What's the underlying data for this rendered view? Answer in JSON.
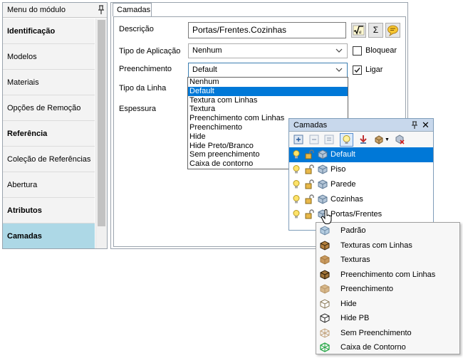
{
  "module_panel": {
    "title": "Menu do módulo",
    "pin_icon": "pin-icon",
    "items": [
      {
        "label": "Identificação",
        "bold": true,
        "selected": false
      },
      {
        "label": "Modelos",
        "bold": false,
        "selected": false
      },
      {
        "label": "Materiais",
        "bold": false,
        "selected": false
      },
      {
        "label": "Opções de Remoção",
        "bold": false,
        "selected": false
      },
      {
        "label": "Referência",
        "bold": true,
        "selected": false
      },
      {
        "label": "Coleção de Referências",
        "bold": false,
        "selected": false
      },
      {
        "label": "Abertura",
        "bold": false,
        "selected": false
      },
      {
        "label": "Atributos",
        "bold": true,
        "selected": false
      },
      {
        "label": "Camadas",
        "bold": true,
        "selected": true
      }
    ]
  },
  "main": {
    "tab_label": "Camadas",
    "descricao": {
      "label": "Descrição",
      "value": "Portas/Frentes.Cozinhas",
      "buttons": [
        "sqrt-icon",
        "Σ",
        "comment-icon"
      ]
    },
    "tipo_aplicacao": {
      "label": "Tipo de Aplicação",
      "value": "Nenhum"
    },
    "bloquear": {
      "label": "Bloquear",
      "checked": false
    },
    "preenchimento": {
      "label": "Preenchimento",
      "value": "Default",
      "options": [
        "Nenhum",
        "Default",
        "Textura com Linhas",
        "Textura",
        "Preenchimento com Linhas",
        "Preenchimento",
        "Hide",
        "Hide Preto/Branco",
        "Sem preenchimento",
        "Caixa de contorno"
      ],
      "selected_index": 1
    },
    "ligar": {
      "label": "Ligar",
      "checked": true
    },
    "tipo_linha": {
      "label": "Tipo da Linha"
    },
    "espessura": {
      "label": "Espessura"
    }
  },
  "layers_panel": {
    "title": "Camadas",
    "pin_icon": "pin-icon",
    "close_label": "✕",
    "toolbar_icons": [
      "add-layer-icon",
      "remove-layer-icon",
      "properties-icon",
      "lightbulb-icon",
      "download-icon",
      "box-dropdown-icon",
      "delete-layer-icon"
    ],
    "layers": [
      {
        "name": "Default",
        "selected": true
      },
      {
        "name": "Piso",
        "selected": false
      },
      {
        "name": "Parede",
        "selected": false
      },
      {
        "name": "Cozinhas",
        "selected": false
      },
      {
        "name": "Portas/Frentes",
        "selected": false
      }
    ]
  },
  "context_menu": {
    "items": [
      {
        "label": "Padrão",
        "icon": "cube-light-blue-icon"
      },
      {
        "label": "Texturas com Linhas",
        "icon": "cube-brown-lines-icon"
      },
      {
        "label": "Texturas",
        "icon": "cube-tan-icon"
      },
      {
        "label": "Preenchimento com Linhas",
        "icon": "cube-dark-brown-icon"
      },
      {
        "label": "Preenchimento",
        "icon": "cube-beige-icon"
      },
      {
        "label": "Hide",
        "icon": "cube-white-outline-icon"
      },
      {
        "label": "Hide PB",
        "icon": "cube-black-outline-icon"
      },
      {
        "label": "Sem Preenchimento",
        "icon": "cube-wireframe-icon"
      },
      {
        "label": "Caixa de Contorno",
        "icon": "cube-green-wireframe-icon"
      }
    ]
  },
  "colors": {
    "selection_blue": "#0078d7",
    "module_selected": "#add8e6",
    "layers_header": "#c8d8ec"
  }
}
